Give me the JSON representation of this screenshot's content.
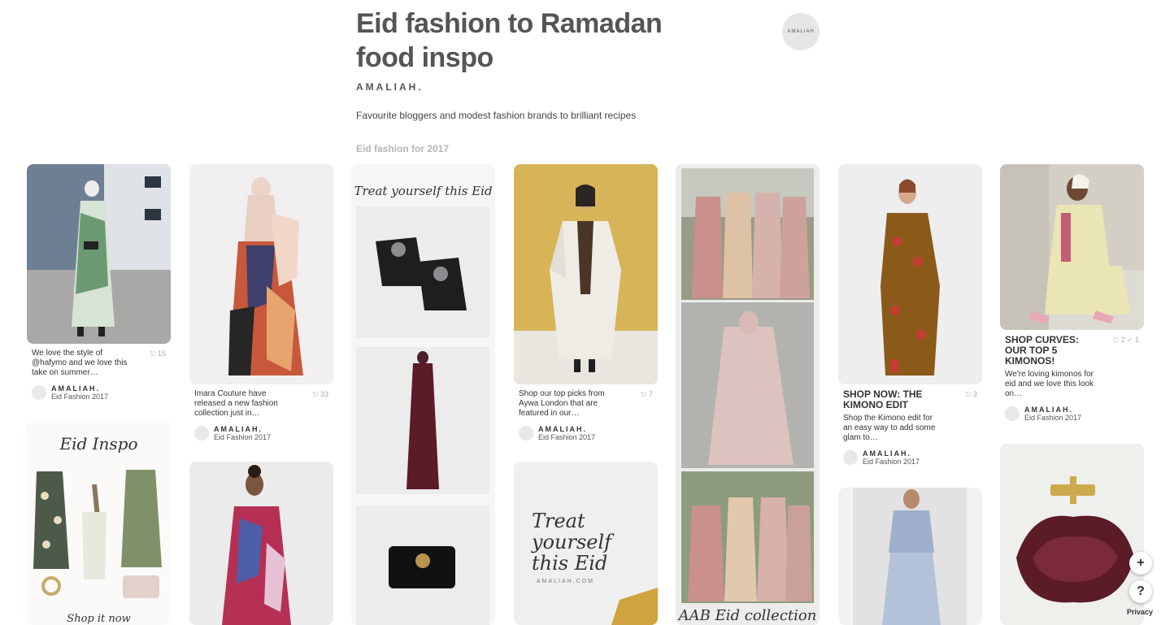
{
  "board": {
    "title": "Eid fashion to Ramadan food inspo",
    "owner": "AMALIAH.",
    "description": "Favourite bloggers and modest fashion brands to brilliant recipes",
    "section": "Eid fashion for 2017",
    "avatar_text": "AMALIAH"
  },
  "pins": [
    {
      "desc": "We love the style of @hafymo and we love this take on summer…",
      "count": "15",
      "owner": "AMALIAH.",
      "board": "Eid Fashion 2017"
    },
    {
      "desc": "Imara Couture have released a new fashion collection just in…",
      "count": "33",
      "owner": "AMALIAH.",
      "board": "Eid Fashion 2017"
    },
    {
      "text": "Treat yourself this Eid"
    },
    {
      "desc": "Shop our top picks from Aywa London that are featured in our…",
      "count": "7",
      "owner": "AMALIAH.",
      "board": "Eid Fashion 2017"
    },
    {
      "text": "AAB Eid collection"
    },
    {
      "title": "SHOP NOW: THE KIMONO EDIT",
      "desc": "Shop the Kimono edit for an easy way to add some glam to…",
      "count": "3",
      "owner": "AMALIAH.",
      "board": "Eid Fashion 2017"
    },
    {
      "title": "SHOP CURVES: OUR TOP 5 KIMONOS!",
      "desc": "We're loving kimonos for eid and we love this look on…",
      "count": "2",
      "count2": "1",
      "owner": "AMALIAH.",
      "board": "Eid Fashion 2017"
    },
    {
      "text": "Eid Inspo",
      "cta": "Shop it now"
    },
    {
      "text": "Treat yourself this Eid",
      "site": "AMALIAH.COM"
    }
  ],
  "fab": {
    "add": "+",
    "help": "?"
  },
  "privacy": "Privacy",
  "colors": {
    "text": "#333333",
    "muted": "#b5b5b5",
    "gold": "#cda94d",
    "burgundy": "#5b1b27"
  }
}
